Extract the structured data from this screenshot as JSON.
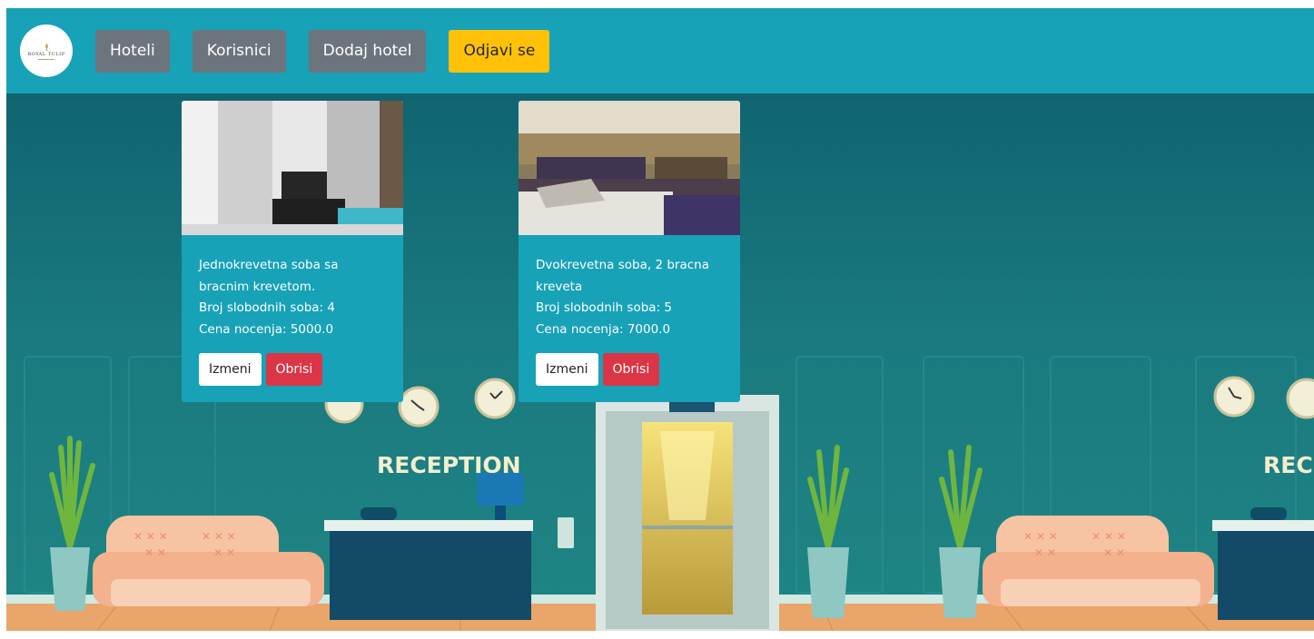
{
  "brand": {
    "logo_text": "ROYAL TULIP"
  },
  "nav": {
    "hotels": "Hoteli",
    "users": "Korisnici",
    "add_hotel": "Dodaj hotel",
    "logout": "Odjavi se"
  },
  "scene": {
    "sign_left": "RECEPTION",
    "sign_right": "RECEI"
  },
  "rooms": [
    {
      "description": "Jednokrevetna soba sa\nbracnim krevetom.",
      "free_rooms": "Broj slobodnih soba: 4",
      "price": "Cena nocenja: 5000.0",
      "edit_label": "Izmeni",
      "delete_label": "Obrisi"
    },
    {
      "description": "Dvokrevetna soba, 2 bracna\nkreveta",
      "free_rooms": "Broj slobodnih soba: 5",
      "price": "Cena nocenja: 7000.0",
      "edit_label": "Izmeni",
      "delete_label": "Obrisi"
    }
  ],
  "colors": {
    "navbar": "#17a2b8",
    "secondary_button": "#6c757d",
    "logout_button": "#ffc107",
    "delete_button": "#dc3545",
    "wall": "#1e7a80"
  }
}
